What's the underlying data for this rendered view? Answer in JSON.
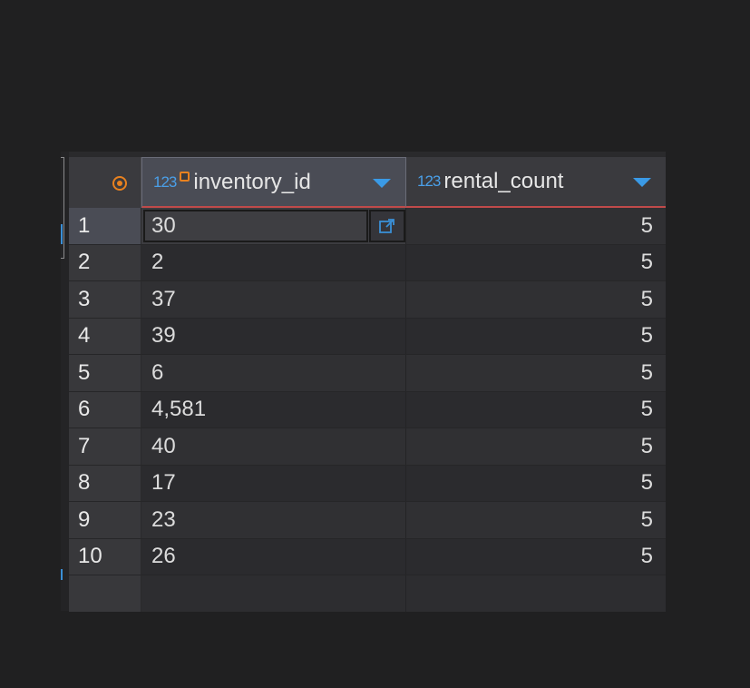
{
  "grid": {
    "columns": [
      {
        "type_icon": "123",
        "label": "inventory_id",
        "key_icon": "key-icon",
        "sort_icon": "sort-down-icon"
      },
      {
        "type_icon": "123",
        "label": "rental_count",
        "sort_icon": "sort-down-icon"
      }
    ],
    "rows": [
      {
        "num": "1",
        "inventory_id": "30",
        "rental_count": "5"
      },
      {
        "num": "2",
        "inventory_id": "2",
        "rental_count": "5"
      },
      {
        "num": "3",
        "inventory_id": "37",
        "rental_count": "5"
      },
      {
        "num": "4",
        "inventory_id": "39",
        "rental_count": "5"
      },
      {
        "num": "5",
        "inventory_id": "6",
        "rental_count": "5"
      },
      {
        "num": "6",
        "inventory_id": "4,581",
        "rental_count": "5"
      },
      {
        "num": "7",
        "inventory_id": "40",
        "rental_count": "5"
      },
      {
        "num": "8",
        "inventory_id": "17",
        "rental_count": "5"
      },
      {
        "num": "9",
        "inventory_id": "23",
        "rental_count": "5"
      },
      {
        "num": "10",
        "inventory_id": "26",
        "rental_count": "5"
      }
    ],
    "selected_row": 1
  },
  "colors": {
    "background": "#202021",
    "accent_orange": "#e8811f",
    "accent_blue": "#3a9ae6",
    "header_underline": "#c04a4a"
  }
}
